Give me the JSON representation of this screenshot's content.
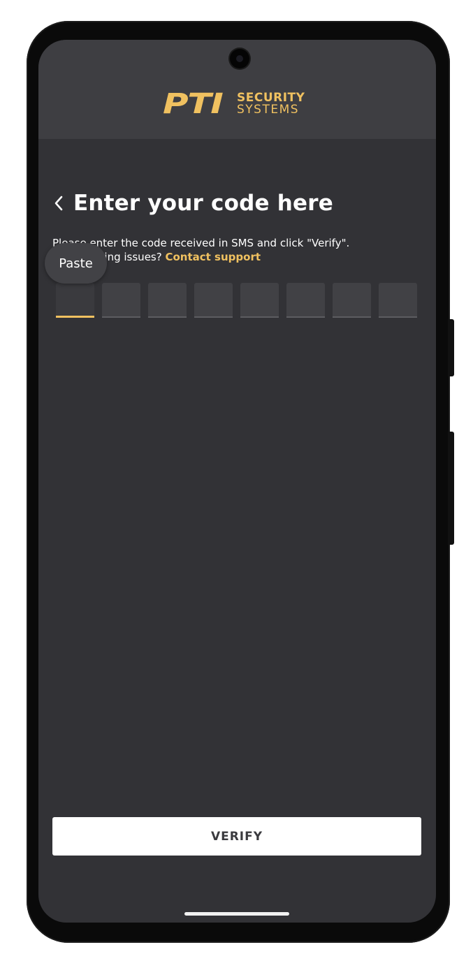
{
  "header": {
    "logo_mark": "PTI",
    "logo_line1": "SECURITY",
    "logo_line2": "SYSTEMS",
    "brand_color": "#f0c160"
  },
  "page": {
    "back_icon": "chevron-left-icon",
    "title": "Enter your code here",
    "description": "Please enter the code received in SMS and click \"Verify\". Experiencing issues?",
    "support_link": "Contact support"
  },
  "paste_tooltip": {
    "label": "Paste"
  },
  "code_inputs": {
    "count": 8,
    "values": [
      "",
      "",
      "",
      "",
      "",
      "",
      "",
      ""
    ],
    "active_index": 0
  },
  "verify_button": {
    "label": "VERIFY"
  },
  "colors": {
    "screen_bg": "#323236",
    "header_bg": "#3e3e42",
    "accent": "#f0c160",
    "button_bg": "#ffffff"
  }
}
